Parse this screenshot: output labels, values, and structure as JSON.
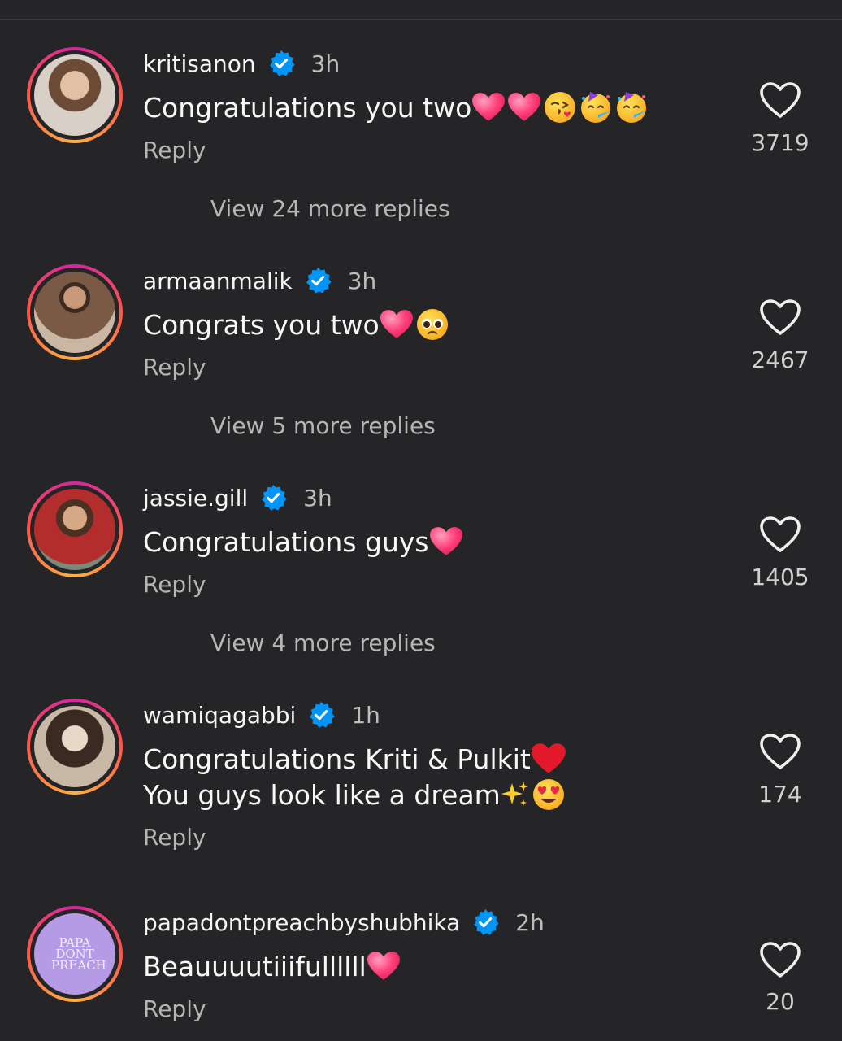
{
  "comments": [
    {
      "username": "kritisanon",
      "time": "3h",
      "text_lines": [
        "Congratulations you two"
      ],
      "reply": "Reply",
      "likes": "3719",
      "view_replies": "View 24 more replies"
    },
    {
      "username": "armaanmalik",
      "time": "3h",
      "text_lines": [
        "Congrats you two "
      ],
      "reply": "Reply",
      "likes": "2467",
      "view_replies": "View 5 more replies"
    },
    {
      "username": "jassie.gill",
      "time": "3h",
      "text_lines": [
        "Congratulations guys "
      ],
      "reply": "Reply",
      "likes": "1405",
      "view_replies": "View 4 more replies"
    },
    {
      "username": "wamiqagabbi",
      "time": "1h",
      "text_lines": [
        "Congratulations Kriti & Pulkit ",
        "You guys look like a dream "
      ],
      "reply": "Reply",
      "likes": "174"
    },
    {
      "username": "papadontpreachbyshubhika",
      "time": "2h",
      "text_lines": [
        "Beauuuutiiifullllll "
      ],
      "reply": "Reply",
      "likes": "20",
      "avatar_text": "PAPA DONT PREACH"
    }
  ],
  "colors": {
    "background": "#252527",
    "verified_badge": "#0095f6",
    "secondary_text": "#b6b6b6"
  },
  "icons": [
    "verified-badge-icon",
    "heart-outline-icon",
    "pink-heart-emoji",
    "red-heart-emoji",
    "kiss-emoji",
    "party-face-emoji",
    "pleading-face-emoji",
    "sparkles-emoji",
    "heart-eyes-emoji"
  ]
}
